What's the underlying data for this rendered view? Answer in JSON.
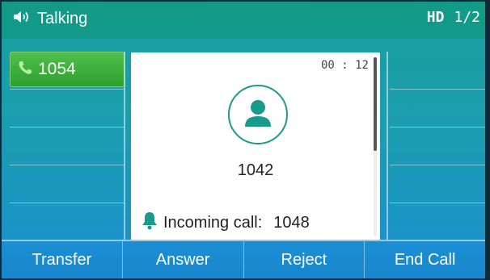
{
  "status_bar": {
    "title": "Talking",
    "icon": "speaker-icon",
    "hd": "HD",
    "page": "1/2"
  },
  "line_keys": {
    "active": {
      "icon": "phone-handset-icon",
      "label": "1054"
    }
  },
  "call": {
    "timer": "00 : 12",
    "caller": "1042",
    "avatar_icon": "person-icon",
    "incoming_label": "Incoming call:",
    "incoming_number": "1048",
    "incoming_icon": "bell-icon"
  },
  "softkeys": [
    "Transfer",
    "Answer",
    "Reject",
    "End Call"
  ],
  "colors": {
    "accent_green": "#2d9f2d",
    "teal": "#1a9a8a",
    "blue": "#1b8fd0"
  }
}
